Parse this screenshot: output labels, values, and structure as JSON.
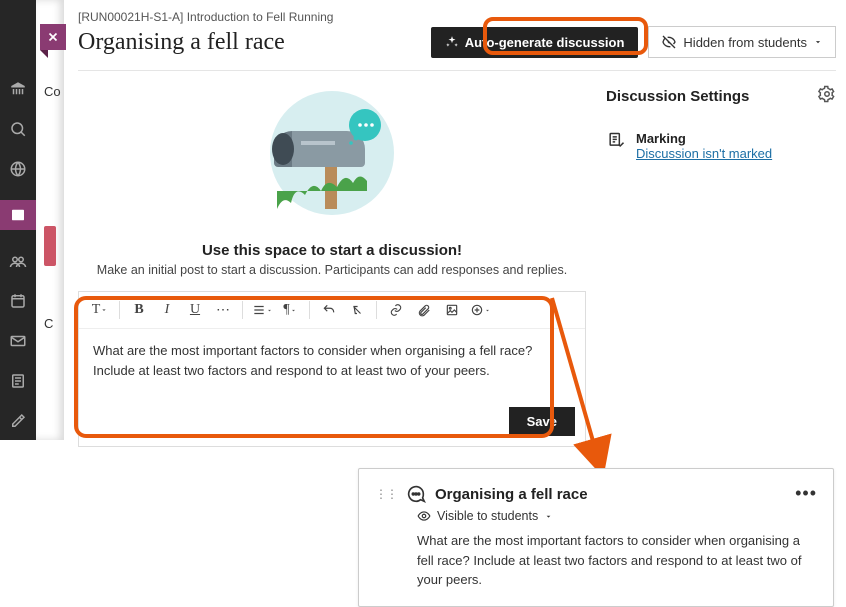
{
  "breadcrumb": "[RUN00021H-S1-A] Introduction to Fell Running",
  "page_title": "Organising a fell race",
  "header": {
    "autogen_label": "Auto-generate discussion",
    "visibility_label": "Hidden from students"
  },
  "sidepeek": {
    "tab1": "Co",
    "tab2": "C"
  },
  "empty_state": {
    "heading": "Use this space to start a discussion!",
    "subtext": "Make an initial post to start a discussion. Participants can add responses and replies."
  },
  "editor": {
    "content": "What are the most important factors to consider when organising a fell race? Include at least two factors and respond to at least two of your peers.",
    "save_label": "Save"
  },
  "settings": {
    "heading": "Discussion Settings",
    "marking_label": "Marking",
    "marking_status": "Discussion isn't marked"
  },
  "result": {
    "title": "Organising a fell race",
    "visibility": "Visible to students",
    "body": "What are the most important factors to consider when organising a fell race? Include at least two factors and respond to at least two of your peers."
  }
}
